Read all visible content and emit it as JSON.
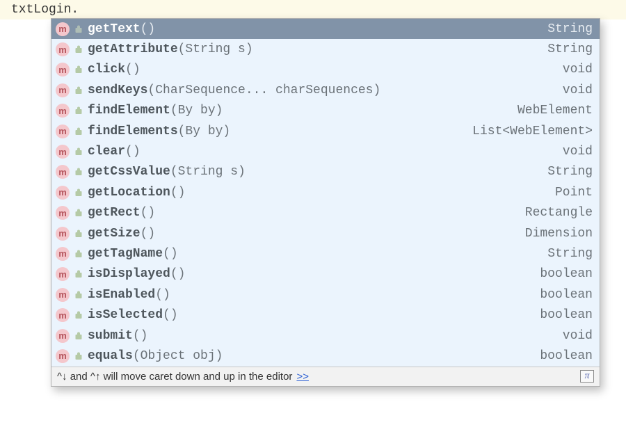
{
  "editor": {
    "var": "txtLogin",
    "dot": "."
  },
  "methodIcon": "m",
  "suggestions": [
    {
      "selected": true,
      "lock": true,
      "name": "getText",
      "params": "()",
      "ret": "String"
    },
    {
      "selected": false,
      "lock": true,
      "name": "getAttribute",
      "params": "(String s)",
      "ret": "String"
    },
    {
      "selected": false,
      "lock": true,
      "name": "click",
      "params": "()",
      "ret": "void"
    },
    {
      "selected": false,
      "lock": true,
      "name": "sendKeys",
      "params": "(CharSequence... charSequences)",
      "ret": "void"
    },
    {
      "selected": false,
      "lock": true,
      "name": "findElement",
      "params": "(By by)",
      "ret": "WebElement"
    },
    {
      "selected": false,
      "lock": true,
      "name": "findElements",
      "params": "(By by)",
      "ret": "List<WebElement>"
    },
    {
      "selected": false,
      "lock": true,
      "name": "clear",
      "params": "()",
      "ret": "void"
    },
    {
      "selected": false,
      "lock": true,
      "name": "getCssValue",
      "params": "(String s)",
      "ret": "String"
    },
    {
      "selected": false,
      "lock": true,
      "name": "getLocation",
      "params": "()",
      "ret": "Point"
    },
    {
      "selected": false,
      "lock": true,
      "name": "getRect",
      "params": "()",
      "ret": "Rectangle"
    },
    {
      "selected": false,
      "lock": true,
      "name": "getSize",
      "params": "()",
      "ret": "Dimension"
    },
    {
      "selected": false,
      "lock": true,
      "name": "getTagName",
      "params": "()",
      "ret": "String"
    },
    {
      "selected": false,
      "lock": true,
      "name": "isDisplayed",
      "params": "()",
      "ret": "boolean"
    },
    {
      "selected": false,
      "lock": true,
      "name": "isEnabled",
      "params": "()",
      "ret": "boolean"
    },
    {
      "selected": false,
      "lock": true,
      "name": "isSelected",
      "params": "()",
      "ret": "boolean"
    },
    {
      "selected": false,
      "lock": true,
      "name": "submit",
      "params": "()",
      "ret": "void"
    },
    {
      "selected": false,
      "lock": true,
      "name": "equals",
      "params": "(Object obj)",
      "ret": "boolean"
    }
  ],
  "hint": {
    "prefix": "^↓ and ^↑ will move caret down and up in the editor",
    "link": ">>",
    "pi": "π"
  }
}
